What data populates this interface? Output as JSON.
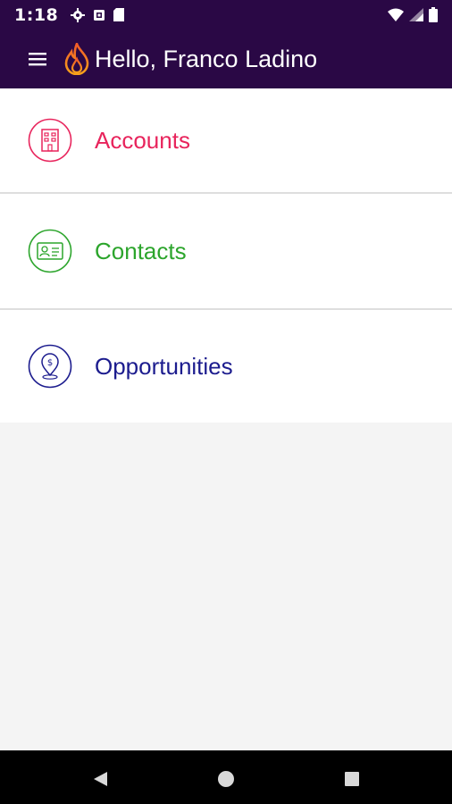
{
  "status_bar": {
    "time": "1:18",
    "left_icons": [
      "settings-icon",
      "notification-icon",
      "sim-icon"
    ],
    "right_icons": [
      "wifi-icon",
      "signal-icon",
      "battery-icon"
    ]
  },
  "app_bar": {
    "title": "Hello, Franco Ladino",
    "menu_icon": "hamburger-menu-icon",
    "logo_icon": "flame-logo-icon"
  },
  "menu": {
    "items": [
      {
        "label": "Accounts",
        "icon": "building-icon",
        "color": "#e8245c"
      },
      {
        "label": "Contacts",
        "icon": "contact-card-icon",
        "color": "#2ca52c"
      },
      {
        "label": "Opportunities",
        "icon": "dollar-location-pin-icon",
        "color": "#1c1c8e"
      }
    ]
  },
  "nav_bar": {
    "buttons": [
      "back-icon",
      "home-icon",
      "recents-icon"
    ]
  },
  "colors": {
    "header_bg": "#2a0845",
    "body_bg": "#f4f4f4"
  }
}
